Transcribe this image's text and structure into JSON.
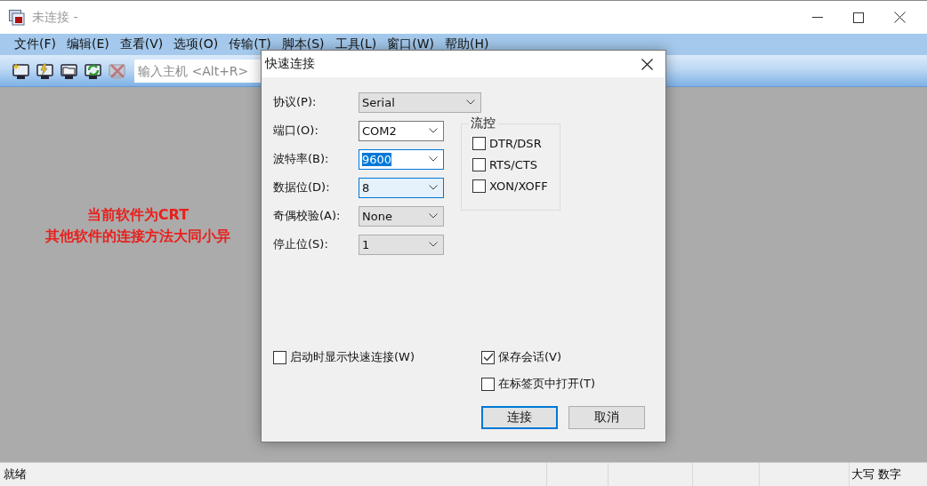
{
  "window": {
    "title": "未连接 -"
  },
  "menu": [
    "文件(F)",
    "编辑(E)",
    "查看(V)",
    "选项(O)",
    "传输(T)",
    "脚本(S)",
    "工具(L)",
    "窗口(W)",
    "帮助(H)"
  ],
  "toolbar": {
    "buttons": [
      {
        "kind": "new",
        "disabled": false
      },
      {
        "kind": "lightning",
        "disabled": false
      },
      {
        "kind": "folder",
        "disabled": false
      },
      {
        "kind": "refresh",
        "disabled": false
      },
      {
        "kind": "disconnect",
        "disabled": true
      }
    ],
    "host_field": {
      "placeholder": "输入主机 <Alt+R>"
    }
  },
  "annotation": [
    "当前软件为CRT",
    "其他软件的连接方法大同小异"
  ],
  "dialog": {
    "title": "快速连接",
    "fields": [
      {
        "label": "协议(P):",
        "value": "Serial",
        "disabled": true,
        "focused": false,
        "hovered": false,
        "wide": true
      },
      {
        "label": "端口(O):",
        "value": "COM2",
        "disabled": false,
        "focused": false,
        "hovered": false,
        "wide": false
      },
      {
        "label": "波特率(B):",
        "value": "9600",
        "disabled": false,
        "focused": true,
        "hovered": false,
        "wide": false
      },
      {
        "label": "数据位(D):",
        "value": "8",
        "disabled": false,
        "focused": false,
        "hovered": true,
        "wide": false
      },
      {
        "label": "奇偶校验(A):",
        "value": "None",
        "disabled": true,
        "focused": false,
        "hovered": false,
        "wide": false
      },
      {
        "label": "停止位(S):",
        "value": "1",
        "disabled": true,
        "focused": false,
        "hovered": false,
        "wide": false
      }
    ],
    "flow_control": {
      "title": "流控",
      "options": [
        {
          "label": "DTR/DSR",
          "checked": false
        },
        {
          "label": "RTS/CTS",
          "checked": false
        },
        {
          "label": "XON/XOFF",
          "checked": false
        }
      ]
    },
    "show_on_startup": {
      "label": "启动时显示快速连接(W)",
      "checked": false
    },
    "save_session": {
      "label": "保存会话(V)",
      "checked": true
    },
    "open_in_tab": {
      "label": "在标签页中打开(T)",
      "checked": false
    },
    "buttons": [
      {
        "label": "连接",
        "default": true
      },
      {
        "label": "取消",
        "default": false
      }
    ]
  },
  "status_bar": {
    "text": "就绪",
    "indicators": [
      "大写",
      "数字"
    ]
  }
}
